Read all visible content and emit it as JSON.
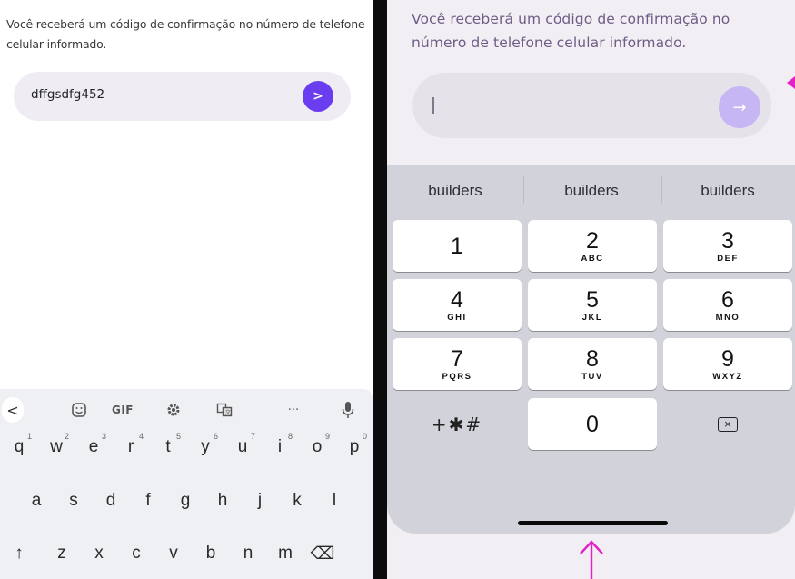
{
  "left": {
    "description": "Você receberá um código de confirmação no número de telefone celular informado.",
    "input_value": "dffgsdfg452",
    "send_label": ">",
    "toolbar": {
      "back": "<",
      "sticker": "sticker-icon",
      "gif": "GIF",
      "settings": "gear-icon",
      "translate": "translate-icon",
      "more": "···",
      "mic": "mic-icon"
    },
    "rows": [
      [
        {
          "k": "q",
          "h": "1"
        },
        {
          "k": "w",
          "h": "2"
        },
        {
          "k": "e",
          "h": "3"
        },
        {
          "k": "r",
          "h": "4"
        },
        {
          "k": "t",
          "h": "5"
        },
        {
          "k": "y",
          "h": "6"
        },
        {
          "k": "u",
          "h": "7"
        },
        {
          "k": "i",
          "h": "8"
        },
        {
          "k": "o",
          "h": "9"
        },
        {
          "k": "p",
          "h": "0"
        }
      ],
      [
        {
          "k": "a"
        },
        {
          "k": "s"
        },
        {
          "k": "d"
        },
        {
          "k": "f"
        },
        {
          "k": "g"
        },
        {
          "k": "h"
        },
        {
          "k": "j"
        },
        {
          "k": "k"
        },
        {
          "k": "l"
        }
      ],
      [
        {
          "k": "↑"
        },
        {
          "k": "z"
        },
        {
          "k": "x"
        },
        {
          "k": "c"
        },
        {
          "k": "v"
        },
        {
          "k": "b"
        },
        {
          "k": "n"
        },
        {
          "k": "m"
        },
        {
          "k": "⌫"
        }
      ]
    ]
  },
  "right": {
    "description": "Você receberá um código de confirmação no número de telefone celular informado.",
    "input_value": "",
    "send_label": "→",
    "suggestions": [
      "builders",
      "builders",
      "builders"
    ],
    "keys": [
      {
        "d": "1",
        "l": ""
      },
      {
        "d": "2",
        "l": "ABC"
      },
      {
        "d": "3",
        "l": "DEF"
      },
      {
        "d": "4",
        "l": "GHI"
      },
      {
        "d": "5",
        "l": "JKL"
      },
      {
        "d": "6",
        "l": "MNO"
      },
      {
        "d": "7",
        "l": "PQRS"
      },
      {
        "d": "8",
        "l": "TUV"
      },
      {
        "d": "9",
        "l": "WXYZ"
      }
    ],
    "symbols_key": "+✱#",
    "zero_key": "0",
    "delete_key": "×",
    "annotation_color": "#e421c6"
  }
}
